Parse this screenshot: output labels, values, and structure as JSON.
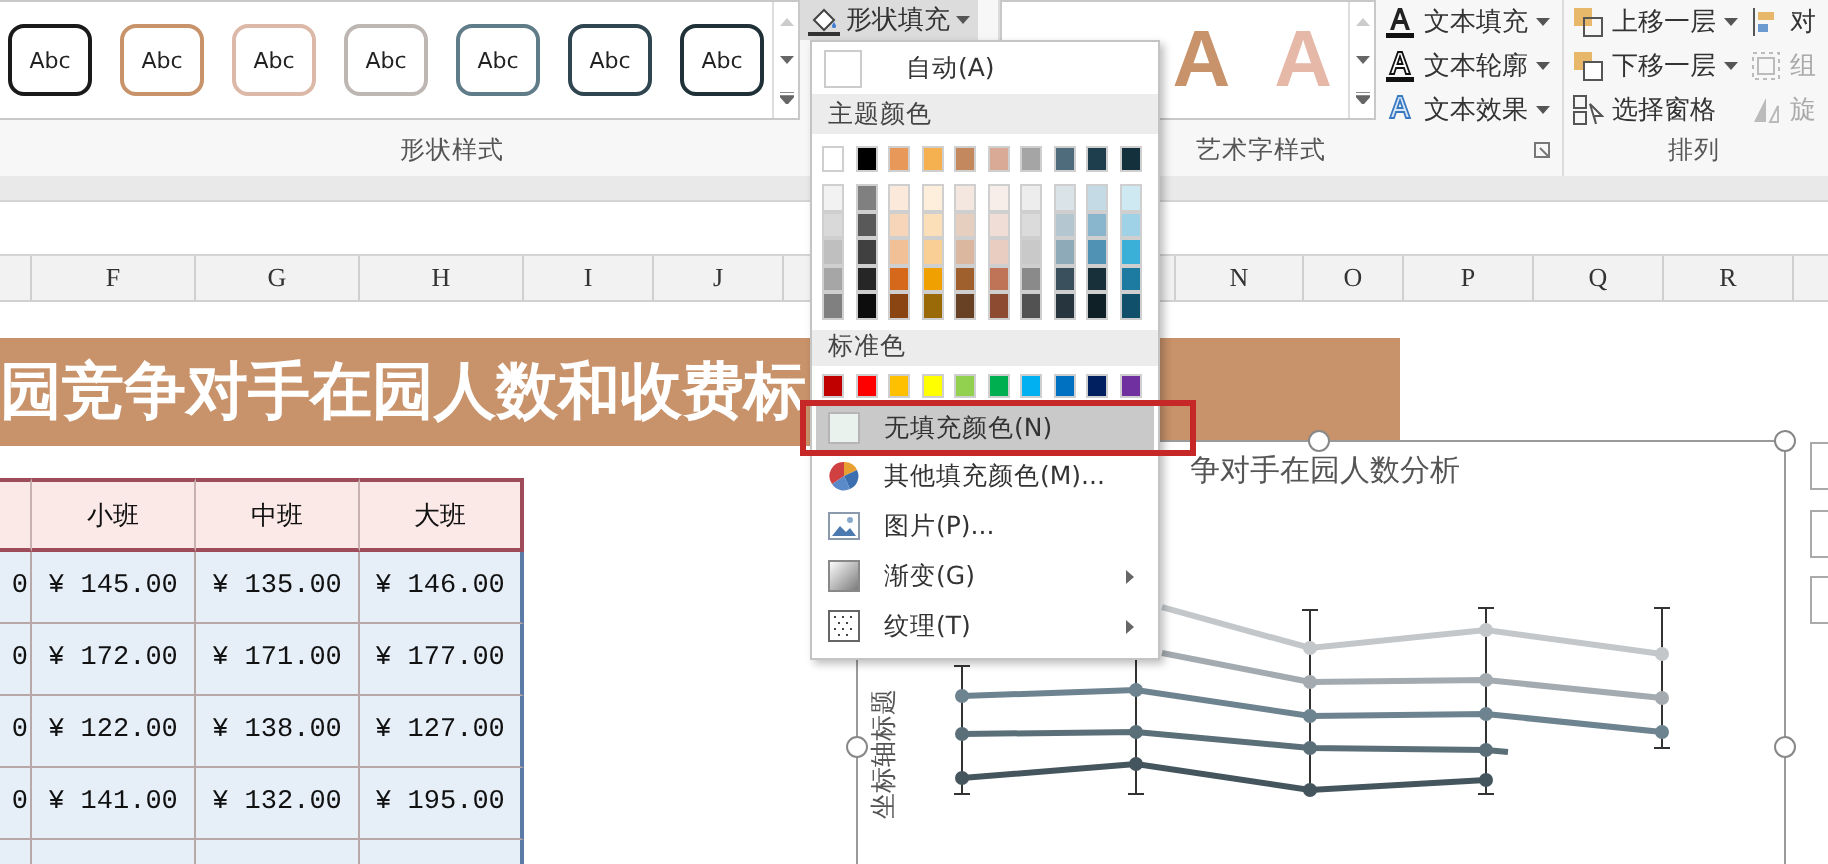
{
  "ribbon": {
    "shape_styles": {
      "items": [
        {
          "label": "Abc",
          "color": "#1a1a1a"
        },
        {
          "label": "Abc",
          "color": "#c8926a"
        },
        {
          "label": "Abc",
          "color": "#dcb8a8"
        },
        {
          "label": "Abc",
          "color": "#bdb6b2"
        },
        {
          "label": "Abc",
          "color": "#607c88"
        },
        {
          "label": "Abc",
          "color": "#2f4550"
        },
        {
          "label": "Abc",
          "color": "#1f3038"
        }
      ],
      "group_label": "形状样式"
    },
    "shape_fill_button": {
      "label": "形状填充",
      "expanded": true
    },
    "art_styles": {
      "items": [
        {
          "letter": "A",
          "color": "#c8926a"
        },
        {
          "letter": "A",
          "color": "#e6b8a8"
        }
      ],
      "group_label": "艺术字样式"
    },
    "text_commands": [
      {
        "label": "文本填充",
        "kind": "fill"
      },
      {
        "label": "文本轮廓",
        "kind": "outline"
      },
      {
        "label": "文本效果",
        "kind": "effect"
      }
    ],
    "arrange": {
      "commands": [
        {
          "label": "上移一层",
          "kind": "bring-forward",
          "menu": true
        },
        {
          "label": "下移一层",
          "kind": "send-backward",
          "menu": true
        },
        {
          "label": "选择窗格",
          "kind": "selection-pane",
          "menu": false
        }
      ],
      "cut_commands": [
        {
          "label": "对",
          "kind": "align",
          "disabled": false
        },
        {
          "label": "组",
          "kind": "group",
          "disabled": true
        },
        {
          "label": "旋",
          "kind": "rotate",
          "disabled": true
        }
      ],
      "group_label": "排列"
    }
  },
  "column_headers": {
    "left": [
      "F",
      "G",
      "H",
      "I",
      "J"
    ],
    "right": [
      "N",
      "O",
      "P",
      "Q",
      "R"
    ]
  },
  "sheet": {
    "banner": "园竞争对手在园人数和收费标",
    "table": {
      "columns": [
        "",
        "小班",
        "中班",
        "大班"
      ],
      "rows": [
        {
          "cells": [
            "0",
            "¥ 145.00",
            "¥ 135.00",
            "¥ 146.00"
          ]
        },
        {
          "cells": [
            "0",
            "¥ 172.00",
            "¥ 171.00",
            "¥ 177.00"
          ]
        },
        {
          "cells": [
            "0",
            "¥ 122.00",
            "¥ 138.00",
            "¥ 127.00"
          ]
        },
        {
          "cells": [
            "0",
            "¥ 141.00",
            "¥ 132.00",
            "¥ 195.00"
          ]
        }
      ]
    },
    "chart": {
      "title": "争对手在园人数分析",
      "y_axis_title": "坐标轴标题"
    }
  },
  "fill_menu": {
    "automatic": "自动(A)",
    "theme_header": "主题颜色",
    "theme_colors": [
      {
        "color": "#ffffff",
        "shades": [
          {
            "color": "#f2f2f2"
          },
          {
            "color": "#d9d9d9"
          },
          {
            "color": "#bfbfbf"
          },
          {
            "color": "#a6a6a6"
          },
          {
            "color": "#808080"
          }
        ]
      },
      {
        "color": "#000000",
        "shades": [
          {
            "color": "#808080"
          },
          {
            "color": "#595959"
          },
          {
            "color": "#404040"
          },
          {
            "color": "#262626"
          },
          {
            "color": "#0d0d0d"
          }
        ]
      },
      {
        "color": "#e8995a",
        "shades": [
          {
            "color": "#fbeadc"
          },
          {
            "color": "#f6d5b9"
          },
          {
            "color": "#f2c096"
          },
          {
            "color": "#d6681c"
          },
          {
            "color": "#8a4512"
          }
        ]
      },
      {
        "color": "#f5b04f",
        "shades": [
          {
            "color": "#fdefdc"
          },
          {
            "color": "#fbdfb9"
          },
          {
            "color": "#f9cf95"
          },
          {
            "color": "#f0a000"
          },
          {
            "color": "#9a6a08"
          }
        ]
      },
      {
        "color": "#c4885f",
        "shades": [
          {
            "color": "#f3e7df"
          },
          {
            "color": "#e7cfbf"
          },
          {
            "color": "#dcb79f"
          },
          {
            "color": "#a0602e"
          },
          {
            "color": "#684125"
          }
        ]
      },
      {
        "color": "#d9ab96",
        "shades": [
          {
            "color": "#f7eeea"
          },
          {
            "color": "#f0ddd5"
          },
          {
            "color": "#e8cdc0"
          },
          {
            "color": "#bf7458"
          },
          {
            "color": "#8d4c32"
          }
        ]
      },
      {
        "color": "#a5a5a5",
        "shades": [
          {
            "color": "#ededed"
          },
          {
            "color": "#dbdbdb"
          },
          {
            "color": "#c9c9c9"
          },
          {
            "color": "#8a8a8a"
          },
          {
            "color": "#525252"
          }
        ]
      },
      {
        "color": "#4e6c7c",
        "shades": [
          {
            "color": "#d9e3e8"
          },
          {
            "color": "#b4c6d0"
          },
          {
            "color": "#8eaab9"
          },
          {
            "color": "#3a515d"
          },
          {
            "color": "#27363e"
          }
        ]
      },
      {
        "color": "#1f3e4d",
        "shades": [
          {
            "color": "#c4dbe6"
          },
          {
            "color": "#8ab6cd"
          },
          {
            "color": "#4f92b4"
          },
          {
            "color": "#17303a"
          },
          {
            "color": "#0f2027"
          }
        ]
      },
      {
        "color": "#14303c",
        "shades": [
          {
            "color": "#cfe9f3"
          },
          {
            "color": "#9fd2e7"
          },
          {
            "color": "#3ab0d8"
          },
          {
            "color": "#1d7aa0"
          },
          {
            "color": "#10506a"
          }
        ]
      }
    ],
    "standard_header": "标准色",
    "standard_colors": [
      {
        "color": "#c00000"
      },
      {
        "color": "#ff0000"
      },
      {
        "color": "#ffc000"
      },
      {
        "color": "#ffff00"
      },
      {
        "color": "#92d050"
      },
      {
        "color": "#00b050"
      },
      {
        "color": "#00b0f0"
      },
      {
        "color": "#0070c0"
      },
      {
        "color": "#002060"
      },
      {
        "color": "#7030a0"
      }
    ],
    "items": [
      {
        "label": "无填充颜色(N)",
        "kind": "no-fill",
        "selected": true,
        "submenu": false
      },
      {
        "label": "其他填充颜色(M)...",
        "kind": "more-colors",
        "selected": false,
        "submenu": false
      },
      {
        "label": "图片(P)...",
        "kind": "picture",
        "selected": false,
        "submenu": false
      },
      {
        "label": "渐变(G)",
        "kind": "gradient",
        "selected": false,
        "submenu": true
      },
      {
        "label": "纹理(T)",
        "kind": "texture",
        "selected": false,
        "submenu": true
      }
    ]
  }
}
